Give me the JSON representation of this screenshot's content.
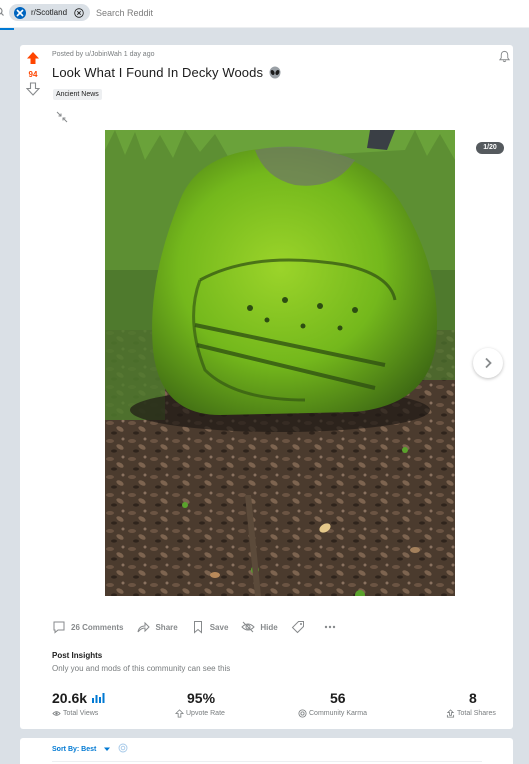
{
  "search": {
    "community_chip": "r/Scotland",
    "placeholder": "Search Reddit"
  },
  "post": {
    "score": "94",
    "posted_by": "Posted by u/JobinWah 1 day ago",
    "title": "Look What I Found In Decky Woods",
    "flair": "Ancient News",
    "gallery_counter": "1/20",
    "actions": {
      "comments": "26 Comments",
      "share": "Share",
      "save": "Save",
      "hide": "Hide"
    },
    "insights": {
      "title": "Post Insights",
      "subtitle": "Only you and mods of this community can see this",
      "stats": [
        {
          "value": "20.6k",
          "label": "Total Views"
        },
        {
          "value": "95%",
          "label": "Upvote Rate"
        },
        {
          "value": "56",
          "label": "Community Karma"
        },
        {
          "value": "8",
          "label": "Total Shares"
        }
      ]
    }
  },
  "sort": {
    "label": "Sort By: Best"
  },
  "colors": {
    "upvote": "#ff4500",
    "accent": "#0079d3",
    "moss": "#7fc41c"
  },
  "icons": [
    "search-icon",
    "subreddit-icon",
    "close-icon",
    "upvote-icon",
    "downvote-icon",
    "bell-icon",
    "alien-icon",
    "collapse-icon",
    "chevron-right-icon",
    "comment-icon",
    "share-icon",
    "save-icon",
    "hide-icon",
    "tag-icon",
    "more-icon",
    "bar-chart-icon",
    "eye-icon",
    "upvote-outline-icon",
    "karma-icon",
    "share-stat-icon",
    "chevron-down-icon"
  ]
}
